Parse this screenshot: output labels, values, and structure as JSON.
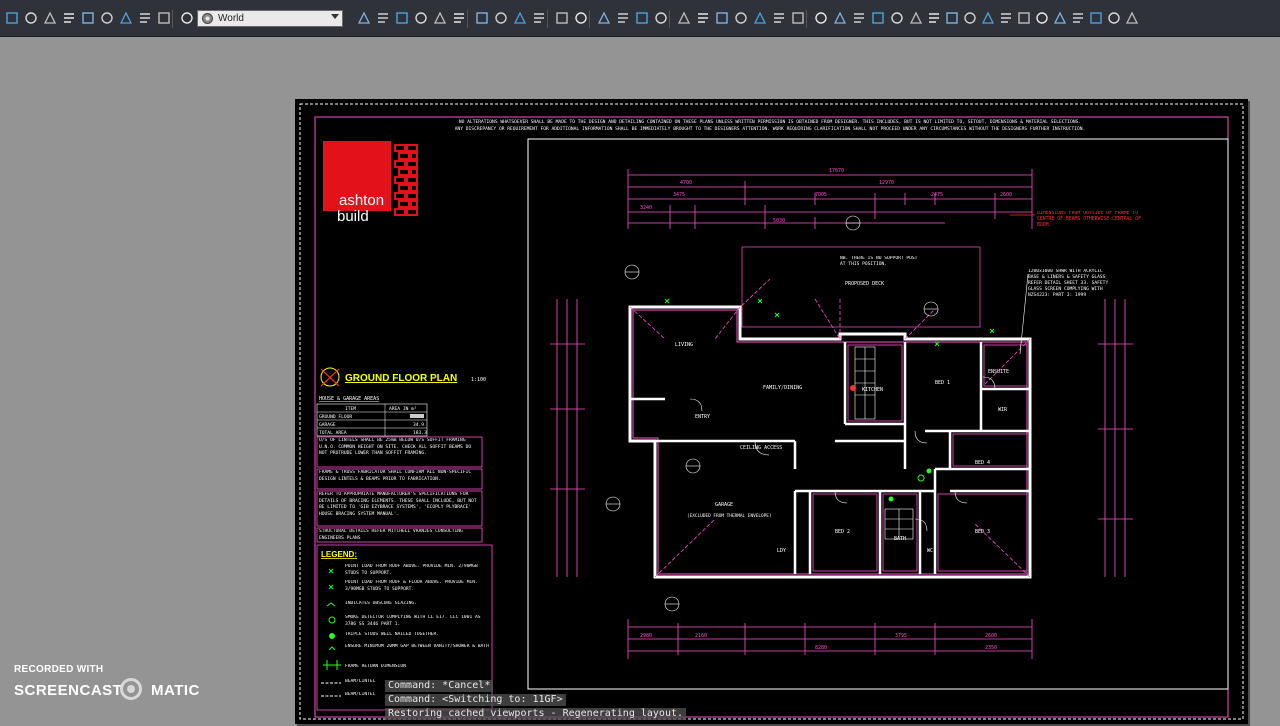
{
  "toolbar": {
    "workspace_label": "World",
    "icons": [
      "cube-icon",
      "view-cube-icon",
      "orbit-icon",
      "settings-gear-icon",
      "visual-style-icon",
      "ucs-2-icon",
      "zoom-icon",
      "ucs-icon",
      "ucs-world-icon",
      "new-icon",
      "open-icon",
      "save-icon",
      "print-icon",
      "print-preview-icon",
      "plot-icon",
      "publish-icon",
      "cut-icon",
      "copy-icon",
      "paste-icon",
      "match-properties-icon",
      "undo-icon",
      "redo-icon",
      "pan-icon",
      "zoom-realtime-icon",
      "zoom-window-icon",
      "zoom-previous-icon",
      "properties-icon",
      "design-center-icon",
      "tool-palettes-icon",
      "sheet-set-icon",
      "markup-icon",
      "quickcalc-icon",
      "help-icon",
      "linear-dimension-icon",
      "aligned-dimension-icon",
      "arc-length-icon",
      "ordinate-icon",
      "radius-icon",
      "jogged-icon",
      "diameter-icon",
      "angular-icon",
      "quick-dim-icon",
      "baseline-icon",
      "continue-icon",
      "space-icon",
      "break-icon",
      "tolerance-icon",
      "center-mark-icon",
      "inspect-icon",
      "jogged-linear-icon",
      "dim-edit-icon"
    ]
  },
  "sheet": {
    "header_note_1": "NO ALTERATIONS WHATSOEVER SHALL BE MADE TO THE DESIGN AND DETAILING CONTAINED ON THESE PLANS UNLESS WRITTEN PERMISSION IS OBTAINED FROM DESIGNER. THIS INCLUDES, BUT IS NOT LIMITED TO, SETOUT, DIMENSIONS & MATERIAL SELECTIONS.",
    "header_note_2": "ANY DISCREPANCY OR REQUIREMENT FOR ADDITIONAL INFORMATION SHALL BE IMMEDIATELY BROUGHT TO THE DESIGNERS ATTENTION. WORK REQUIRING CLARIFICATION SHALL NOT PROCEED UNDER ANY CIRCUMSTANCES WITHOUT THE DESIGNERS FURTHER INSTRUCTION.",
    "logo_line1": "ashton",
    "logo_line2": "build",
    "plan_title": "GROUND FLOOR PLAN",
    "plan_scale": "1:100",
    "areas_title": "HOUSE & GARAGE AREAS",
    "areas_col1": "ITEM",
    "areas_col2": "AREA IN m²",
    "areas_rows": [
      {
        "item": "GROUND FLOOR",
        "area": ""
      },
      {
        "item": "GARAGE",
        "area": "34.9"
      },
      {
        "item": "TOTAL AREA",
        "area": "183.3"
      }
    ],
    "notes": [
      "U/S OF LINTELS SHALL BE 25mm BELOW U/S SOFFIT FRAMING U.N.O. COMMON HEIGHT ON SITE. CHECK ALL SOFFIT BEAMS DO NOT PROTRUDE LOWER THAN SOFFIT FRAMING.",
      "FRAME & TRUSS FABRICATOR SHALL CONFIRM ALL NON-SPECIFIC DESIGN LINTELS & BEAMS PRIOR TO FABRICATION.",
      "REFER TO APPROPRIATE MANUFACTURER'S SPECIFICATIONS FOR DETAILS OF BRACING ELEMENTS. THESE SHALL INCLUDE, BUT NOT BE LIMITED TO 'GIB EZYBRACE SYSTEMS', 'ECOPLY PLYBRACE' HOUSE BRACING SYSTEM MANUAL'.",
      "STRUCTURAL DETAILS REFER MITCHELL VRANJES CONSULTING ENGINEERS PLANS"
    ],
    "legend_title": "LEGEND:",
    "legend_items": [
      "POINT LOAD FROM ROOF ABOVE. PROVIDE MIN. 2/90MGB STUDS TO SUPPORT.",
      "POINT LOAD FROM ROOF & FLOOR ABOVE. PROVIDE MIN. 3/90MGB STUDS TO SUPPORT.",
      "INDICATES OBSCURE GLAZING.",
      "SMOKE DETECTOR COMPLYING WITH LL E17. LLC 1001 AS 3786 SS 3446 PART 1.",
      "TRIPLE STUDS WELL NAILED TOGETHER.",
      "ENSURE MINIMUM 20MM GAP BETWEEN VANITY/SHOWER & BATH",
      "FRAME RETURN DIMENSION",
      "BEAM/LINTEL",
      "BEAM/LINTEL"
    ],
    "rooms": {
      "living": "LIVING",
      "family": "FAMILY/DINING",
      "kitchen": "KITCHEN",
      "bed1": "BED 1",
      "ensuite": "ENSUITE",
      "wir": "WIR",
      "bed2": "BED 2",
      "bed3": "BED 3",
      "bed4": "BED 4",
      "bath": "BATH",
      "wc": "WC",
      "laundry": "LDY",
      "entry": "ENTRY",
      "garage": "GARAGE",
      "garage_note": "(EXCLUDED FROM THERMAL ENVELOPE)",
      "deck": "PROPOSED DECK",
      "deck_note": "NB. THERE IS NO SUPPORT POST AT THIS POSITION.",
      "ceiling": "CEILING ACCESS"
    },
    "annotation_red": "DIMENSIONS FROM OUTSIDE OF FRAME TO CENTRE OF BEAMS OTHERWISE CENTRAL OF BOOM.",
    "annotation_white": "1200x1000 SHWR WITH ACRYLIC BASE & LINERS & SAFETY GLASS REFER DETAIL SHEET 33. SAFETY GLASS SCREEN COMPLYING WITH NZS4223: PART 3: 1999",
    "dims_top": [
      "17670",
      "4700",
      "12970",
      "7005",
      "2475",
      "3475",
      "2600",
      "3240",
      "5030"
    ],
    "dims_bottom": [
      "2980",
      "2160",
      "8280",
      "3795",
      "2600",
      "2350"
    ]
  },
  "command": {
    "line1": "Command: *Cancel*",
    "line2": "Command: <Switching to: 11GF>",
    "line3": "Restoring cached viewports - Regenerating layout."
  },
  "watermark": {
    "line1": "RECORDED WITH",
    "brand1": "SCREENCAST",
    "brand2": "MATIC"
  }
}
